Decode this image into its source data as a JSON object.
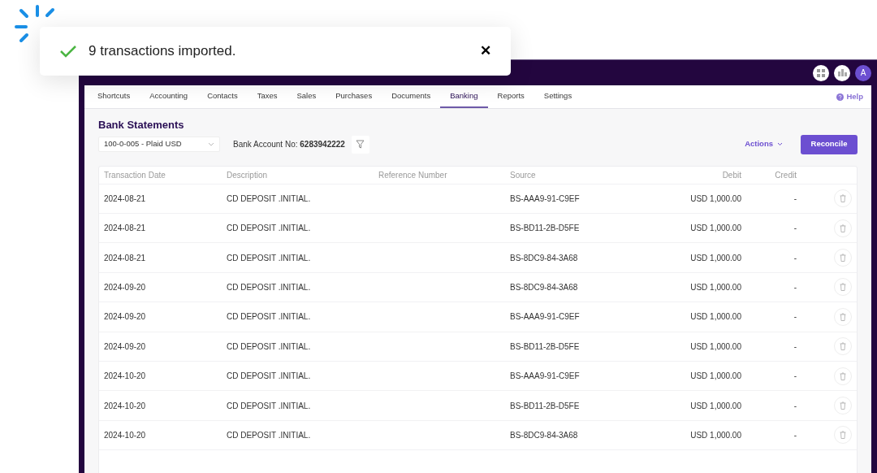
{
  "toast": {
    "message": "9 transactions imported.",
    "close": "✕"
  },
  "top_bar": {
    "avatar": "A"
  },
  "tabs": [
    {
      "label": "Shortcuts",
      "selected": false
    },
    {
      "label": "Accounting",
      "selected": false
    },
    {
      "label": "Contacts",
      "selected": false
    },
    {
      "label": "Taxes",
      "selected": false
    },
    {
      "label": "Sales",
      "selected": false
    },
    {
      "label": "Purchases",
      "selected": false
    },
    {
      "label": "Documents",
      "selected": false
    },
    {
      "label": "Banking",
      "selected": true
    },
    {
      "label": "Reports",
      "selected": false
    },
    {
      "label": "Settings",
      "selected": false
    }
  ],
  "help": "Help",
  "page_title": "Bank Statements",
  "account_select": {
    "value": "100-0-005 - Plaid USD"
  },
  "bank_account": {
    "label": "Bank Account No:",
    "number": "6283942222"
  },
  "actions": "Actions",
  "reconcile": "Reconcile",
  "table": {
    "columns": [
      "Transaction Date",
      "Description",
      "Reference Number",
      "Source",
      "Debit",
      "Credit"
    ],
    "rows": [
      {
        "date": "2024-08-21",
        "description": "CD DEPOSIT .INITIAL.",
        "source": "BS-AAA9-91-C9EF",
        "debit": "USD 1,000.00",
        "credit": "-"
      },
      {
        "date": "2024-08-21",
        "description": "CD DEPOSIT .INITIAL.",
        "source": "BS-BD11-2B-D5FE",
        "debit": "USD 1,000.00",
        "credit": "-"
      },
      {
        "date": "2024-08-21",
        "description": "CD DEPOSIT .INITIAL.",
        "source": "BS-8DC9-84-3A68",
        "debit": "USD 1,000.00",
        "credit": "-"
      },
      {
        "date": "2024-09-20",
        "description": "CD DEPOSIT .INITIAL.",
        "source": "BS-8DC9-84-3A68",
        "debit": "USD 1,000.00",
        "credit": "-"
      },
      {
        "date": "2024-09-20",
        "description": "CD DEPOSIT .INITIAL.",
        "source": "BS-AAA9-91-C9EF",
        "debit": "USD 1,000.00",
        "credit": "-"
      },
      {
        "date": "2024-09-20",
        "description": "CD DEPOSIT .INITIAL.",
        "source": "BS-BD11-2B-D5FE",
        "debit": "USD 1,000.00",
        "credit": "-"
      },
      {
        "date": "2024-10-20",
        "description": "CD DEPOSIT .INITIAL.",
        "source": "BS-AAA9-91-C9EF",
        "debit": "USD 1,000.00",
        "credit": "-"
      },
      {
        "date": "2024-10-20",
        "description": "CD DEPOSIT .INITIAL.",
        "source": "BS-BD11-2B-D5FE",
        "debit": "USD 1,000.00",
        "credit": "-"
      },
      {
        "date": "2024-10-20",
        "description": "CD DEPOSIT .INITIAL.",
        "source": "BS-8DC9-84-3A68",
        "debit": "USD 1,000.00",
        "credit": "-"
      }
    ]
  }
}
